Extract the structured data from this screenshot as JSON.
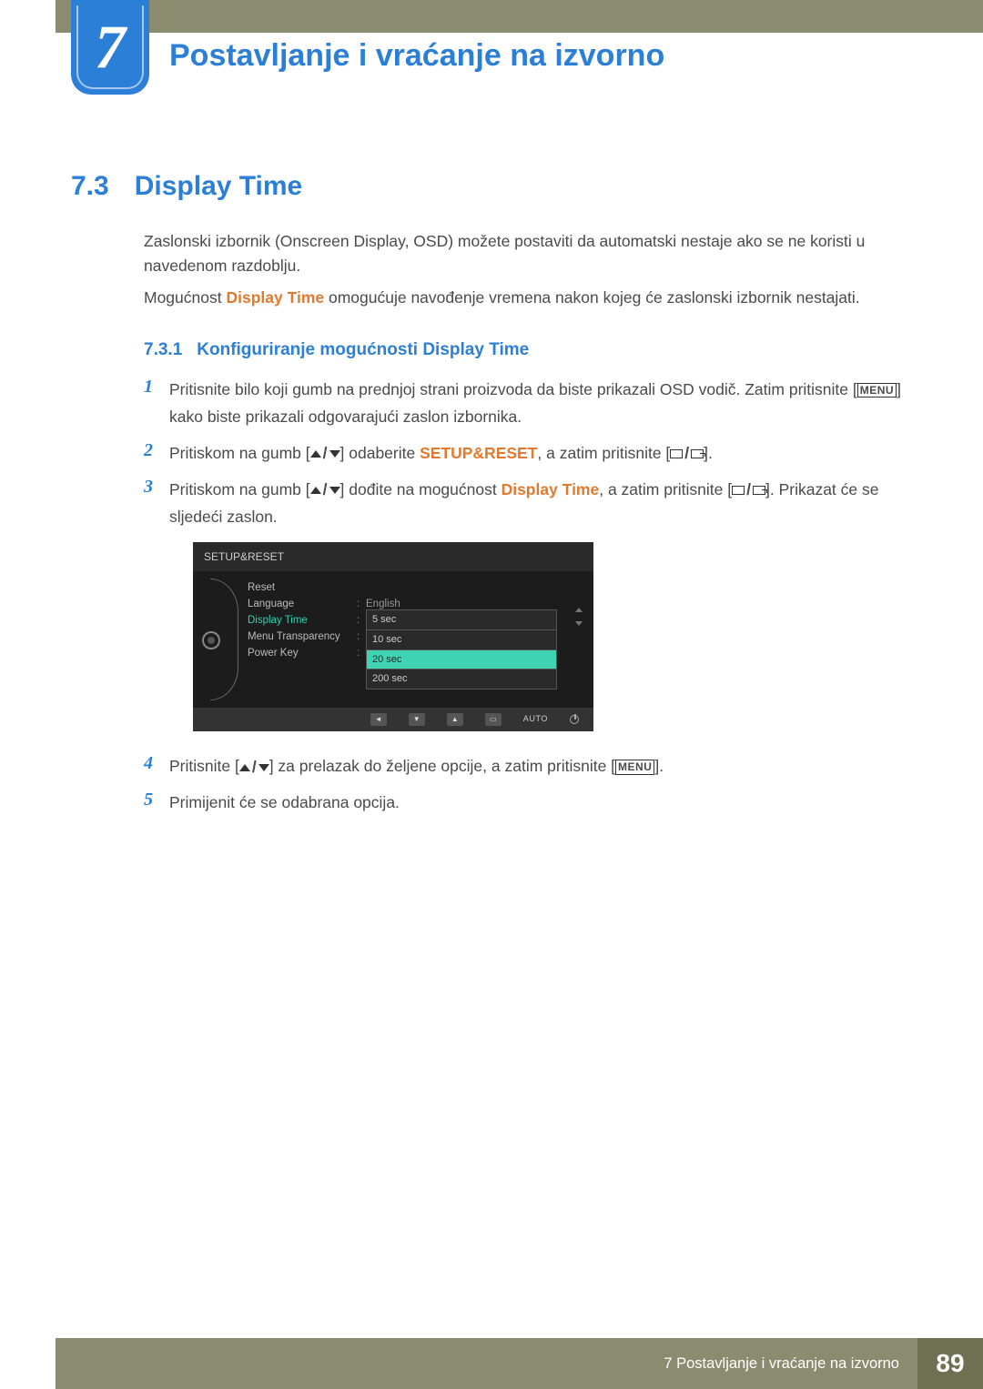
{
  "chapter": {
    "number": "7",
    "title": "Postavljanje i vraćanje na izvorno"
  },
  "section": {
    "number": "7.3",
    "title": "Display Time",
    "intro1": "Zaslonski izbornik (Onscreen Display, OSD) možete postaviti da automatski nestaje ako se ne koristi u navedenom razdoblju.",
    "intro2_a": "Mogućnost ",
    "intro2_b": "Display Time",
    "intro2_c": " omogućuje navođenje vremena nakon kojeg će zaslonski izbornik nestajati."
  },
  "subsection": {
    "number": "7.3.1",
    "title": "Konfiguriranje mogućnosti Display Time"
  },
  "steps": {
    "s1_a": "Pritisnite bilo koji gumb na prednjoj strani proizvoda da biste prikazali OSD vodič. Zatim pritisnite [",
    "s1_menu": "MENU",
    "s1_b": "] kako biste prikazali odgovarajući zaslon izbornika.",
    "s2_a": "Pritiskom na gumb [",
    "s2_b": "] odaberite ",
    "s2_setup": "SETUP&RESET",
    "s2_c": ", a zatim pritisnite [",
    "s2_d": "].",
    "s3_a": "Pritiskom na gumb [",
    "s3_b": "] dođite na mogućnost ",
    "s3_dt": "Display Time",
    "s3_c": ", a zatim pritisnite [",
    "s3_d": "]. Prikazat će se sljedeći zaslon.",
    "s4_a": "Pritisnite [",
    "s4_b": "] za prelazak do željene opcije, a zatim pritisnite [",
    "s4_menu": "MENU",
    "s4_c": "].",
    "s5": "Primijenit će se odabrana opcija."
  },
  "osd": {
    "title": "SETUP&RESET",
    "items": {
      "reset": "Reset",
      "language": "Language",
      "language_val": "English",
      "display_time": "Display Time",
      "menu_transparency": "Menu Transparency",
      "power_key": "Power Key"
    },
    "options": [
      "5 sec",
      "10 sec",
      "20 sec",
      "200 sec"
    ],
    "selected_index": 2,
    "footer_auto": "AUTO"
  },
  "footer": {
    "label": "7 Postavljanje i vraćanje na izvorno",
    "page": "89"
  }
}
